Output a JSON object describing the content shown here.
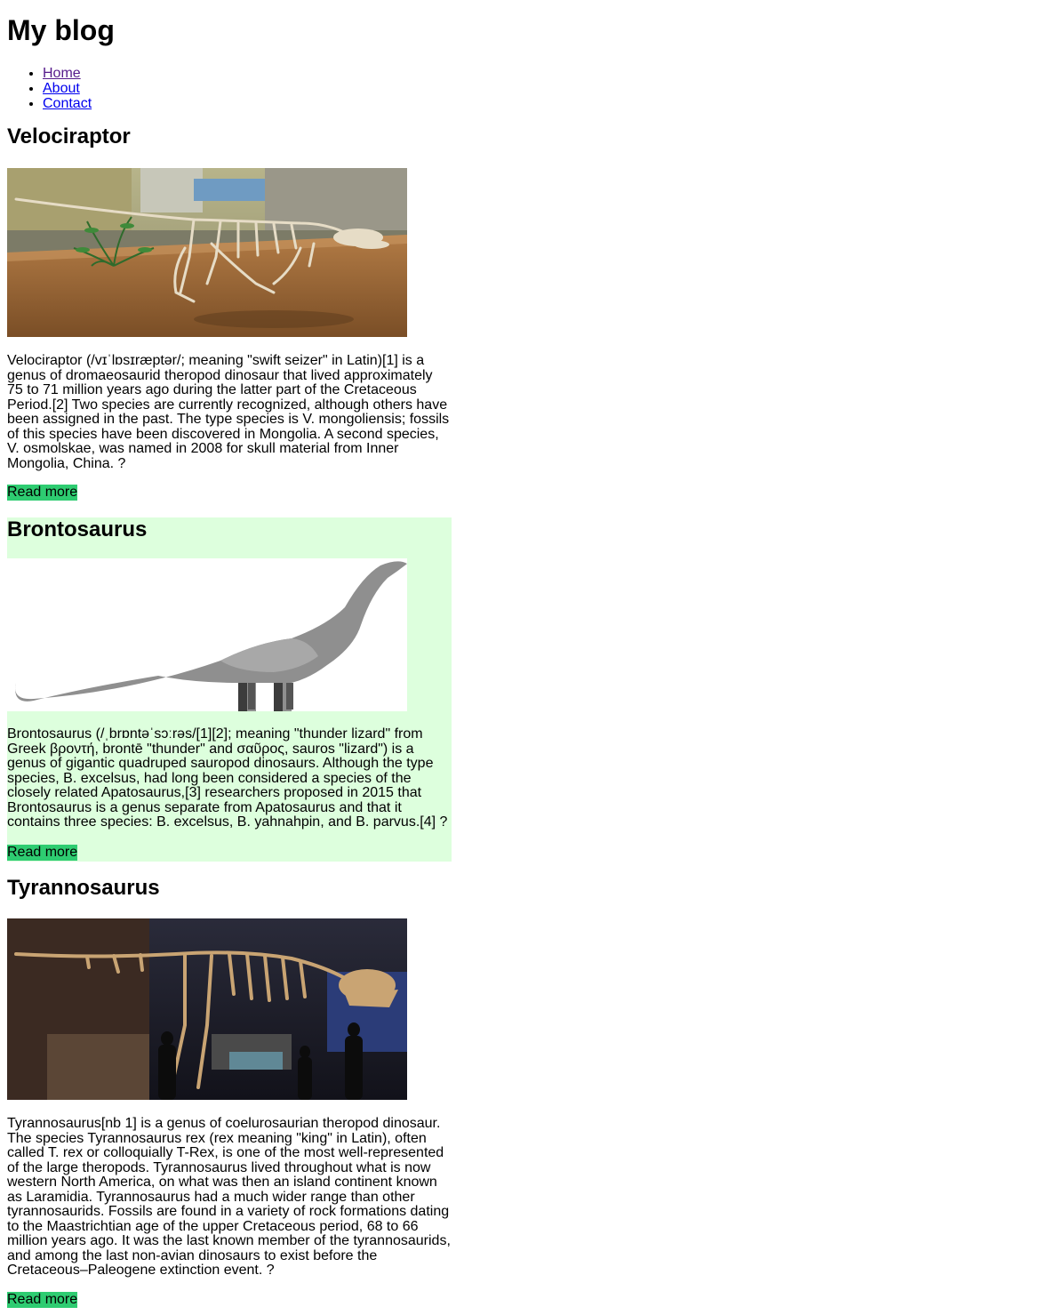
{
  "site": {
    "title": "My blog"
  },
  "nav": {
    "items": [
      {
        "label": "Home"
      },
      {
        "label": "About"
      },
      {
        "label": "Contact"
      }
    ]
  },
  "posts": [
    {
      "title": "Velociraptor",
      "image_alt": "Velociraptor skeleton in a museum display",
      "body": "Velociraptor (/vɪˈlɒsɪræptər/; meaning \"swift seizer\" in Latin)[1] is a genus of dromaeosaurid theropod dinosaur that lived approximately 75 to 71 million years ago during the latter part of the Cretaceous Period.[2] Two species are currently recognized, although others have been assigned in the past. The type species is V. mongoliensis; fossils of this species have been discovered in Mongolia. A second species, V. osmolskae, was named in 2008 for skull material from Inner Mongolia, China. ?",
      "read_more": "Read more"
    },
    {
      "title": "Brontosaurus",
      "image_alt": "Brontosaurus illustration",
      "body": "Brontosaurus (/ˌbrɒntəˈsɔːrəs/[1][2]; meaning \"thunder lizard\" from Greek βροντή, brontē \"thunder\" and σαῦρος, sauros \"lizard\") is a genus of gigantic quadruped sauropod dinosaurs. Although the type species, B. excelsus, had long been considered a species of the closely related Apatosaurus,[3] researchers proposed in 2015 that Brontosaurus is a genus separate from Apatosaurus and that it contains three species: B. excelsus, B. yahnahpin, and B. parvus.[4] ?",
      "read_more": "Read more"
    },
    {
      "title": "Tyrannosaurus",
      "image_alt": "Tyrannosaurus skeleton in a museum hall",
      "body": "Tyrannosaurus[nb 1] is a genus of coelurosaurian theropod dinosaur. The species Tyrannosaurus rex (rex meaning \"king\" in Latin), often called T. rex or colloquially T-Rex, is one of the most well-represented of the large theropods. Tyrannosaurus lived throughout what is now western North America, on what was then an island continent known as Laramidia. Tyrannosaurus had a much wider range than other tyrannosaurids. Fossils are found in a variety of rock formations dating to the Maastrichtian age of the upper Cretaceous period, 68 to 66 million years ago. It was the last known member of the tyrannosaurids, and among the last non-avian dinosaurs to exist before the Cretaceous–Paleogene extinction event. ?",
      "read_more": "Read more"
    }
  ],
  "colors": {
    "highlight_bg": "#ddffdd",
    "read_more_bg": "#2ecc71",
    "link": "#0000ee",
    "visited_link": "#551a8b"
  }
}
